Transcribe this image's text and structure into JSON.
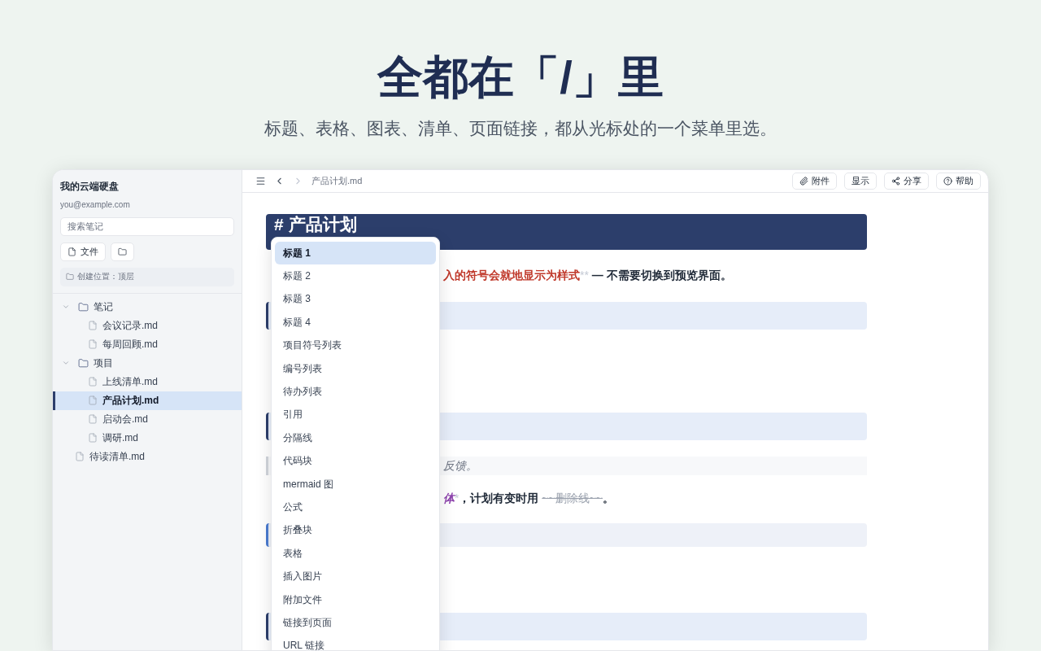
{
  "hero": {
    "title": "全都在「/」里",
    "subtitle": "标题、表格、图表、清单、页面链接，都从光标处的一个菜单里选。"
  },
  "sidebar": {
    "account": "我的云端硬盘",
    "email": "you@example.com",
    "search": {
      "placeholder": "搜索笔记"
    },
    "buttons": [
      {
        "kind": "file",
        "label": "文件"
      },
      {
        "kind": "folder"
      }
    ],
    "location": "创建位置：顶层",
    "tree": [
      {
        "kind": "folder",
        "label": "笔记",
        "expanded": true,
        "selected": false,
        "children": [
          {
            "kind": "file",
            "label": "会议记录.md",
            "selected": false
          },
          {
            "kind": "file",
            "label": "每周回顾.md",
            "selected": false
          }
        ]
      },
      {
        "kind": "folder",
        "label": "项目",
        "expanded": true,
        "selected": false,
        "children": [
          {
            "kind": "file",
            "label": "上线清单.md",
            "selected": false
          },
          {
            "kind": "file",
            "label": "产品计划.md",
            "selected": true
          },
          {
            "kind": "file",
            "label": "启动会.md",
            "selected": false
          },
          {
            "kind": "file",
            "label": "调研.md",
            "selected": false
          }
        ]
      },
      {
        "kind": "file",
        "label": "待读清单.md",
        "selected": false
      }
    ]
  },
  "toolbar": {
    "breadcrumb": "产品计划.md",
    "actions": [
      {
        "kind": "attach",
        "label": "附件"
      },
      {
        "kind": "plain",
        "label": "显示"
      },
      {
        "kind": "share",
        "label": "分享"
      },
      {
        "kind": "help",
        "label": "帮助"
      }
    ]
  },
  "editor": {
    "blocks": [
      {
        "kind": "heading1",
        "text": "# 产品计划"
      },
      {
        "kind": "paragraph",
        "segments": [
          {
            "kind": "strong",
            "text": "入的符号会就地显示为样式"
          },
          {
            "kind": "marker",
            "text": "**"
          },
          {
            "kind": "plain",
            "text": " — 不需要切换到预览界面。"
          }
        ]
      },
      {
        "kind": "heading2"
      },
      {
        "kind": "heading2"
      },
      {
        "kind": "quote",
        "text": "反馈。"
      },
      {
        "kind": "paragraph",
        "segments": [
          {
            "kind": "italic",
            "text": "体"
          },
          {
            "kind": "marker",
            "text": "*"
          },
          {
            "kind": "plain",
            "text": "，计划有变时用 "
          },
          {
            "kind": "strike",
            "text": "~~删除线~~"
          },
          {
            "kind": "plain",
            "text": "。"
          }
        ]
      },
      {
        "kind": "callout"
      },
      {
        "kind": "heading2"
      }
    ]
  },
  "slash_menu": {
    "items": [
      {
        "label": "标题 1",
        "selected": true
      },
      {
        "label": "标题 2",
        "selected": false
      },
      {
        "label": "标题 3",
        "selected": false
      },
      {
        "label": "标题 4",
        "selected": false
      },
      {
        "label": "项目符号列表",
        "selected": false
      },
      {
        "label": "编号列表",
        "selected": false
      },
      {
        "label": "待办列表",
        "selected": false
      },
      {
        "label": "引用",
        "selected": false
      },
      {
        "label": "分隔线",
        "selected": false
      },
      {
        "label": "代码块",
        "selected": false
      },
      {
        "label": "mermaid 图",
        "selected": false
      },
      {
        "label": "公式",
        "selected": false
      },
      {
        "label": "折叠块",
        "selected": false
      },
      {
        "label": "表格",
        "selected": false
      },
      {
        "label": "插入图片",
        "selected": false
      },
      {
        "label": "附加文件",
        "selected": false
      },
      {
        "label": "链接到页面",
        "selected": false
      },
      {
        "label": "URL 链接",
        "selected": false
      }
    ]
  }
}
